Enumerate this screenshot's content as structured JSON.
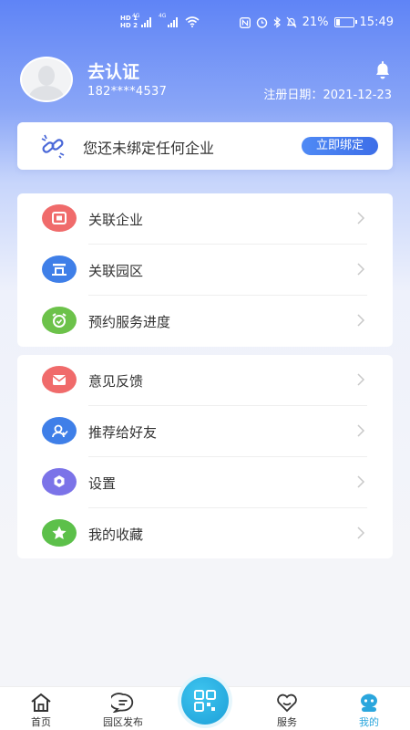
{
  "status_bar": {
    "hd1": "HD 1",
    "hd2": "HD 2",
    "net1": "4G",
    "net2": "4G",
    "battery_percent": "21%",
    "battery_level": 0.21,
    "time": "15:49"
  },
  "profile": {
    "name": "去认证",
    "phone": "182****4537",
    "register_label": "注册日期：",
    "register_date": "2021-12-23"
  },
  "bind": {
    "text": "您还未绑定任何企业",
    "button": "立即绑定"
  },
  "menu_group1": [
    {
      "label": "关联企业",
      "icon": "company-icon",
      "color": "#f06b6b"
    },
    {
      "label": "关联园区",
      "icon": "park-icon",
      "color": "#3f7fe8"
    },
    {
      "label": "预约服务进度",
      "icon": "alarm-clock-icon",
      "color": "#6cc24a"
    }
  ],
  "menu_group2": [
    {
      "label": "意见反馈",
      "icon": "feedback-mail-icon",
      "color": "#f06b6b"
    },
    {
      "label": "推荐给好友",
      "icon": "recommend-user-icon",
      "color": "#3f7fe8"
    },
    {
      "label": "设置",
      "icon": "settings-gear-icon",
      "color": "#7b73e8"
    },
    {
      "label": "我的收藏",
      "icon": "favorite-star-icon",
      "color": "#5cc04a"
    }
  ],
  "nav": {
    "home": "首页",
    "park_post": "园区发布",
    "service": "服务",
    "mine": "我的"
  },
  "colors": {
    "accent": "#2aa6dd",
    "header_blue": "#5f84f6"
  }
}
